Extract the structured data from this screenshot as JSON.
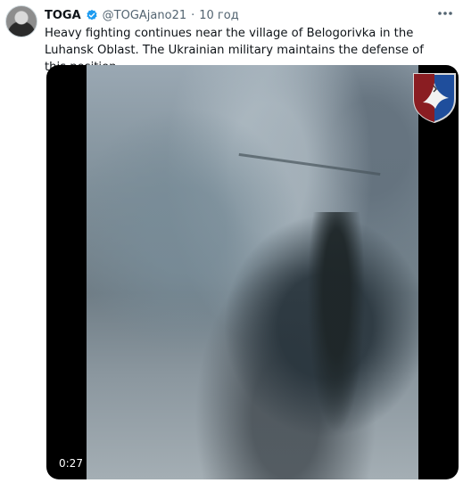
{
  "tweet": {
    "author_name": "TOGA",
    "handle": "@TOGAjano21",
    "separator": "·",
    "time_ago": "10 год",
    "text": "Heavy fighting continues near the village of Belogorivka in the Luhansk Oblast. The Ukrainian military maintains the defense of this position."
  },
  "video": {
    "timestamp": "0:27"
  },
  "icons": {
    "verified": "verified-badge-icon",
    "more": "more-options-icon",
    "emblem": "military-unit-emblem-icon"
  },
  "colors": {
    "verified": "#1d9bf0",
    "secondary_text": "#536471",
    "emblem_red": "#8a1d22",
    "emblem_blue": "#1f4e9c"
  }
}
